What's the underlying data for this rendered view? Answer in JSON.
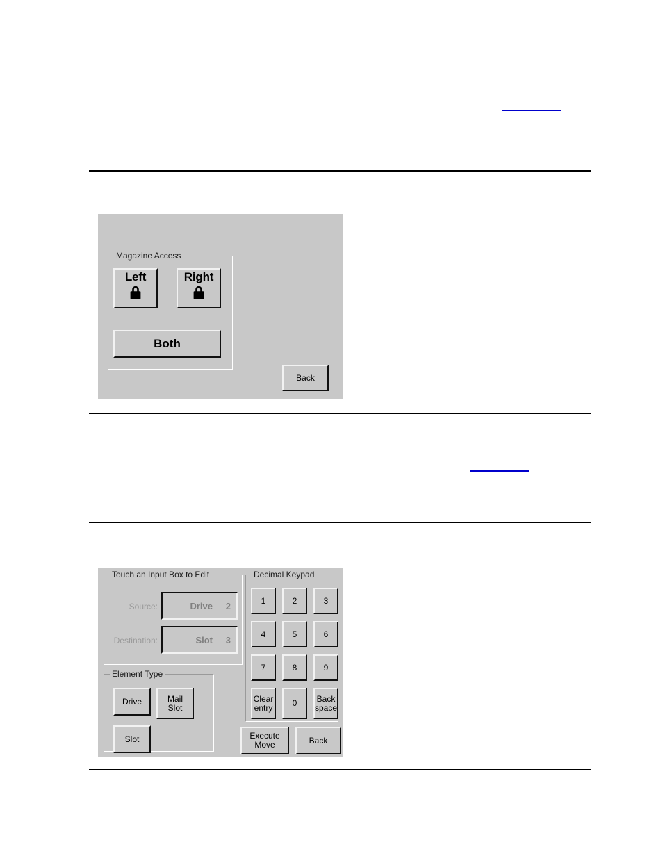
{
  "page": {
    "links": [
      {
        "name": "cross-reference-link-top",
        "text": ""
      },
      {
        "name": "cross-reference-link-middle",
        "text": ""
      }
    ]
  },
  "magazine_panel": {
    "group_title": "Magazine Access",
    "buttons": {
      "left": {
        "label": "Left",
        "icon": "lock-icon"
      },
      "right": {
        "label": "Right",
        "icon": "lock-icon"
      },
      "both": {
        "label": "Both"
      },
      "back": {
        "label": "Back"
      }
    }
  },
  "move_panel": {
    "input_group_title": "Touch an Input Box to Edit",
    "fields": [
      {
        "label": "Source:",
        "element": "Drive",
        "number": "2"
      },
      {
        "label": "Destination:",
        "element": "Slot",
        "number": "3"
      }
    ],
    "element_type": {
      "group_title": "Element Type",
      "buttons": [
        {
          "name": "element-type-drive-button",
          "line1": "Drive",
          "line2": ""
        },
        {
          "name": "element-type-mail-slot-button",
          "line1": "Mail",
          "line2": "Slot"
        },
        {
          "name": "element-type-slot-button",
          "line1": "Slot",
          "line2": ""
        }
      ]
    },
    "keypad": {
      "group_title": "Decimal Keypad",
      "keys": [
        {
          "name": "keypad-key-1",
          "line1": "1",
          "line2": ""
        },
        {
          "name": "keypad-key-2",
          "line1": "2",
          "line2": ""
        },
        {
          "name": "keypad-key-3",
          "line1": "3",
          "line2": ""
        },
        {
          "name": "keypad-key-4",
          "line1": "4",
          "line2": ""
        },
        {
          "name": "keypad-key-5",
          "line1": "5",
          "line2": ""
        },
        {
          "name": "keypad-key-6",
          "line1": "6",
          "line2": ""
        },
        {
          "name": "keypad-key-7",
          "line1": "7",
          "line2": ""
        },
        {
          "name": "keypad-key-8",
          "line1": "8",
          "line2": ""
        },
        {
          "name": "keypad-key-9",
          "line1": "9",
          "line2": ""
        },
        {
          "name": "keypad-key-clear-entry",
          "line1": "Clear",
          "line2": "entry"
        },
        {
          "name": "keypad-key-0",
          "line1": "0",
          "line2": ""
        },
        {
          "name": "keypad-key-backspace",
          "line1": "Back",
          "line2": "space"
        }
      ]
    },
    "actions": {
      "execute_move": {
        "line1": "Execute",
        "line2": "Move"
      },
      "back": {
        "line1": "Back",
        "line2": ""
      }
    }
  },
  "colors": {
    "panel_bg": "#c8c8c8",
    "link": "#0000cc",
    "rule": "#000000",
    "disabled_text": "#808080"
  }
}
